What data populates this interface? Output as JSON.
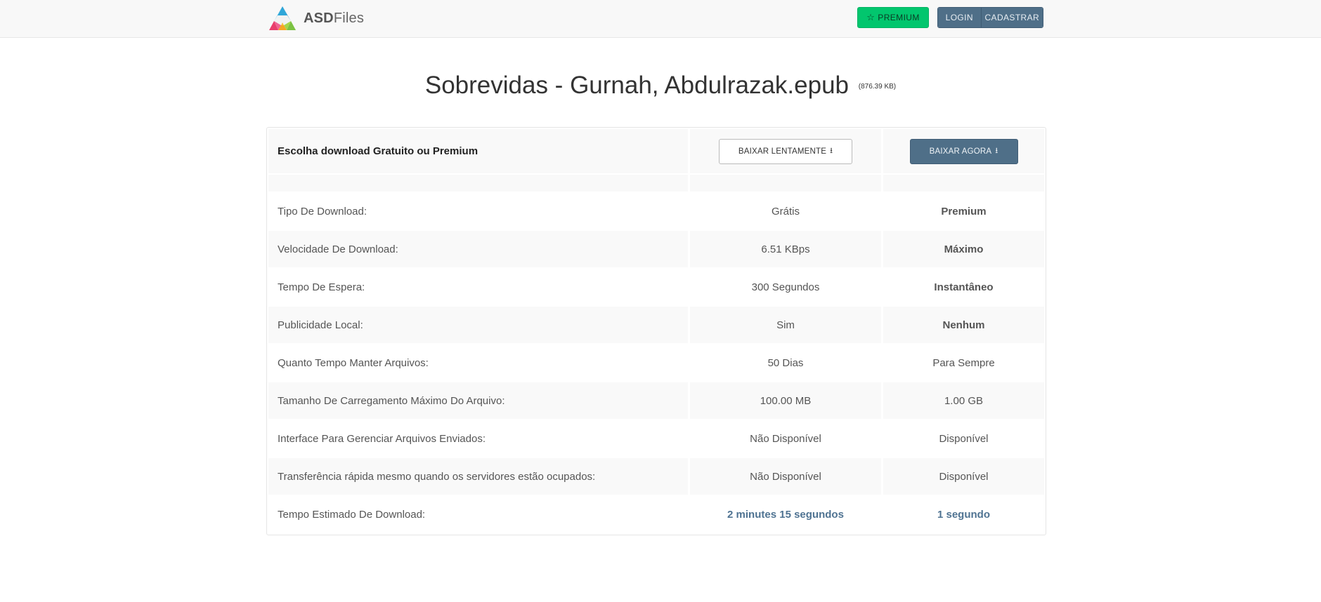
{
  "header": {
    "brand_bold": "ASD",
    "brand_rest": "Files",
    "premium_label": "PREMIUM",
    "login_label": "LOGIN",
    "register_label": "CADASTRAR"
  },
  "file": {
    "name": "Sobrevidas - Gurnah, Abdulrazak.epub",
    "size": "(876.39 KB)"
  },
  "panel": {
    "heading": "Escolha download Gratuito ou Premium",
    "slow_button": "BAIXAR LENTAMENTE",
    "fast_button": "BAIXAR AGORA"
  },
  "rows": [
    {
      "label": "Tipo De Download:",
      "free": "Grátis",
      "premium": "Premium"
    },
    {
      "label": "Velocidade De Download:",
      "free": "6.51 KBps",
      "premium": "Máximo"
    },
    {
      "label": "Tempo De Espera:",
      "free": "300 Segundos",
      "premium": "Instantâneo"
    },
    {
      "label": "Publicidade Local:",
      "free": "Sim",
      "premium": "Nenhum"
    },
    {
      "label": "Quanto Tempo Manter Arquivos:",
      "free": "50 Dias",
      "premium": "Para Sempre"
    },
    {
      "label": "Tamanho De Carregamento Máximo Do Arquivo:",
      "free": "100.00 MB",
      "premium": "1.00 GB"
    },
    {
      "label": "Interface Para Gerenciar Arquivos Enviados:",
      "free": "Não Disponível",
      "premium": "Disponível"
    },
    {
      "label": "Transferência rápida mesmo quando os servidores estão ocupados:",
      "free": "Não Disponível",
      "premium": "Disponível"
    },
    {
      "label": "Tempo Estimado De Download:",
      "free": "2 minutes 15 segundos",
      "premium": "1 segundo"
    }
  ],
  "colors": {
    "premium_green": "#02c66e",
    "slate_button": "#4f6f88",
    "accent_text": "#4f7392"
  }
}
